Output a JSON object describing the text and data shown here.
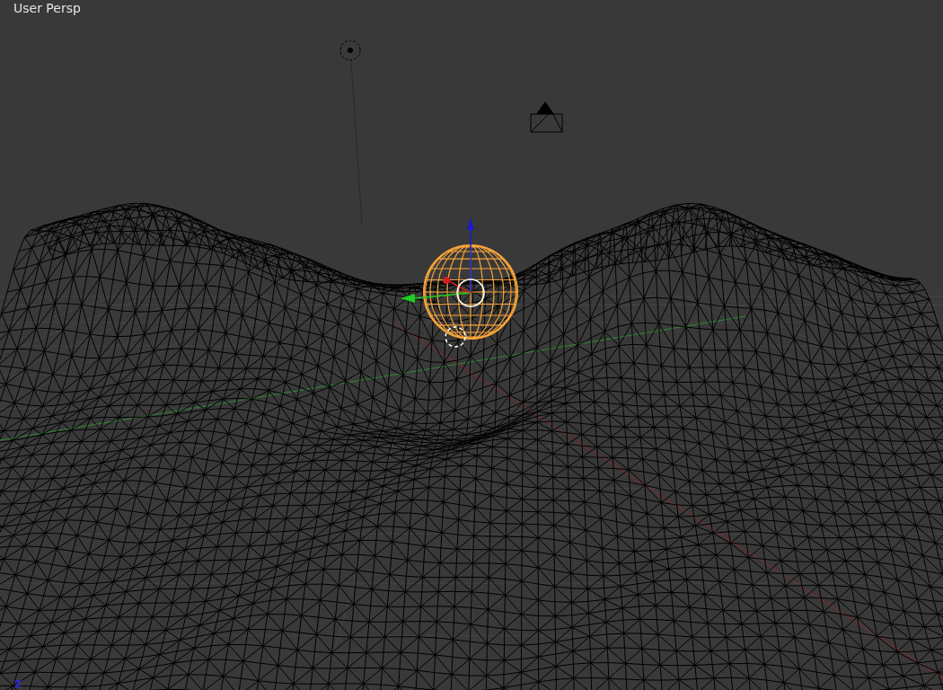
{
  "viewport": {
    "view_label": "User Persp",
    "axis_label": "Z"
  }
}
